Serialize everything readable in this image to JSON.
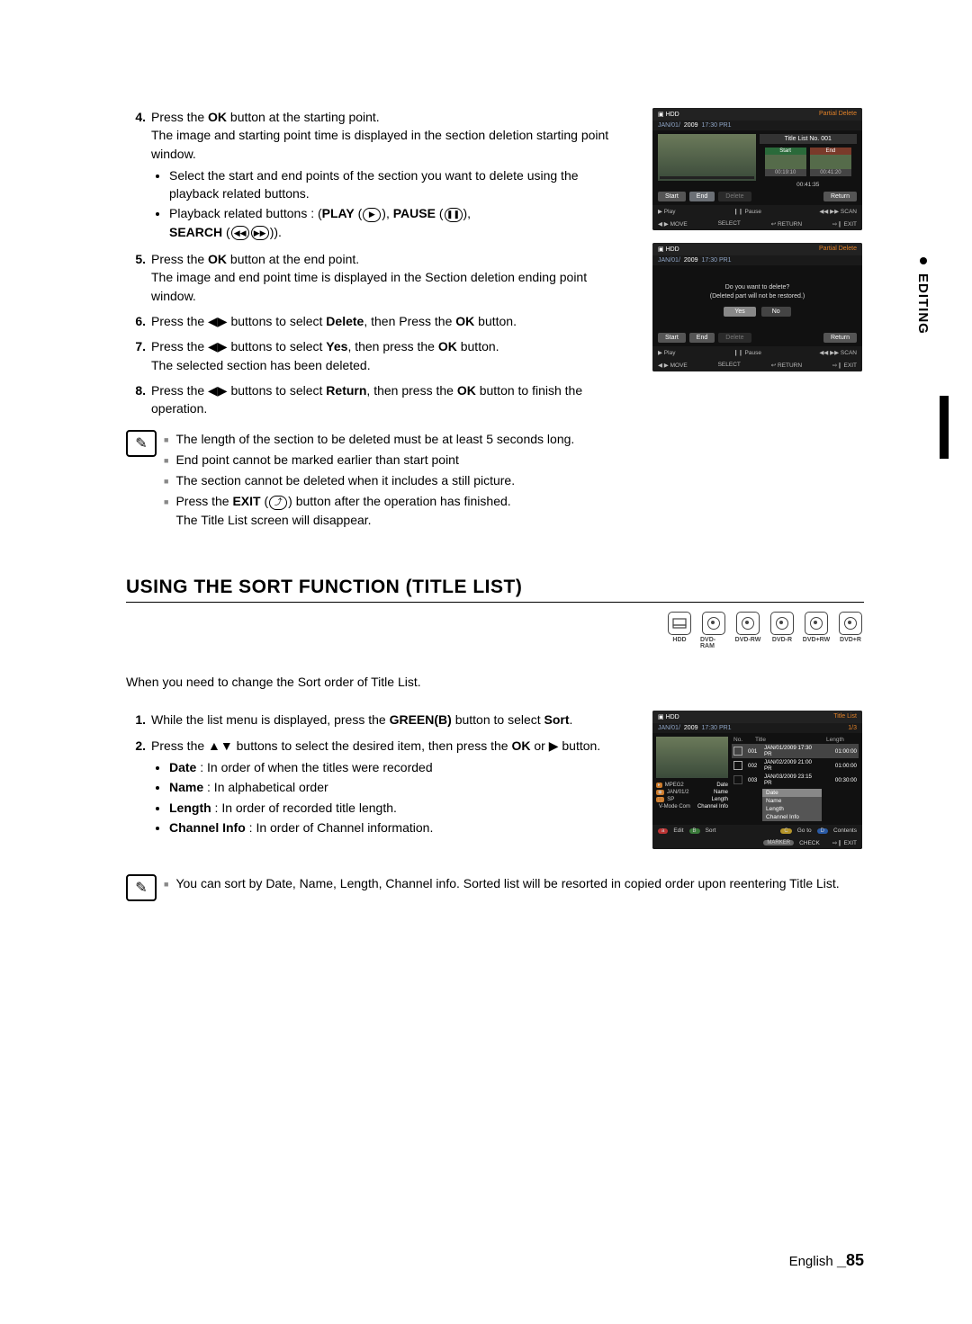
{
  "side_tab": "EDITING",
  "step4": {
    "num": "4.",
    "line1_a": "Press the ",
    "line1_b": "OK",
    "line1_c": " button at the starting point.",
    "line2": "The image and starting point time is displayed in the section deletion starting point window.",
    "b1": "Select the start and end points of the section you want to delete using the playback related buttons.",
    "b2_a": "Playback related buttons : (",
    "b2_play": "PLAY",
    "b2_pause": "PAUSE",
    "b2_search": "SEARCH",
    "b2_end": ")."
  },
  "step5": {
    "num": "5.",
    "l1a": "Press the ",
    "l1b": "OK",
    "l1c": " button at the end point.",
    "l2": "The image and end point time is displayed in the Section deletion ending point window."
  },
  "step6": {
    "num": "6.",
    "a": "Press the ◀▶ buttons to select ",
    "b": "Delete",
    "c": ", then Press the ",
    "d": "OK",
    "e": " button."
  },
  "step7": {
    "num": "7.",
    "a": "Press the ◀▶ buttons to select ",
    "b": "Yes",
    "c": ", then press the ",
    "d": "OK",
    "e": " button.",
    "f": "The selected section has been deleted."
  },
  "step8": {
    "num": "8.",
    "a": "Press the ◀▶ buttons to select ",
    "b": "Return",
    "c": ", then press the ",
    "d": "OK",
    "e": " button to finish the operation."
  },
  "notesA": {
    "n1": "The length of the section to be deleted must be at least 5 seconds long.",
    "n2": "End point cannot be marked earlier than start point",
    "n3": "The section cannot be deleted when it includes a still picture.",
    "n4a": "Press the ",
    "n4b": "EXIT",
    "n4c": " button after the operation has finished.",
    "n4d": "The Title List screen will disappear."
  },
  "heading2": "USING THE SORT FUNCTION (TITLE LIST)",
  "discs": [
    "HDD",
    "DVD-RAM",
    "DVD-RW",
    "DVD-R",
    "DVD+RW",
    "DVD+R"
  ],
  "intro2": "When you need to change the Sort order of Title List.",
  "s1": {
    "num": "1.",
    "a": "While the list menu is displayed, press the ",
    "b": "GREEN(B)",
    "c": " button to select ",
    "d": "Sort",
    "e": "."
  },
  "s2": {
    "num": "2.",
    "a": "Press the ▲▼ buttons to select the desired item, then press the ",
    "b": "OK",
    "c": " or ▶ button.",
    "d_date_b": "Date",
    "d_date": " : In order of when the titles were recorded",
    "d_name_b": "Name",
    "d_name": " : In alphabetical order",
    "d_len_b": "Length",
    "d_len": " : In order of recorded title length.",
    "d_ch_b": "Channel Info",
    "d_ch": " : In order of Channel information."
  },
  "notesB": {
    "n1": "You can sort by Date, Name, Length, Channel info. Sorted list will be resorted in copied order upon reentering Title List."
  },
  "footer": {
    "lang": "English ",
    "page": "_85"
  },
  "shot1": {
    "hdd": "HDD",
    "mode": "Partial Delete",
    "date1": "JAN/01/",
    "date2": "2009",
    "date3": " 17:30 PR1",
    "title": "Title List No. 001",
    "start": "Start",
    "end": "End",
    "t1": "00:19:10",
    "t2": "00:41:20",
    "t3": "00:41:35",
    "btns": [
      "Start",
      "End",
      "Delete",
      "Return"
    ],
    "f_play": "▶ Play",
    "f_pause": "❙❙ Pause",
    "f_scan": "◀◀ ▶▶  SCAN",
    "f_move": "◀ ▶ MOVE",
    "f_sel": "SELECT",
    "f_ret": "↩ RETURN",
    "f_exit": "⇨❙ EXIT"
  },
  "shot2": {
    "hdd": "HDD",
    "mode": "Partial Delete",
    "date1": "JAN/01/",
    "date2": "2009",
    "date3": " 17:30 PR1",
    "msg1": "Do you want to delete?",
    "msg2": "(Deleted part will not be restored.)",
    "yes": "Yes",
    "no": "No",
    "btns": [
      "Start",
      "End",
      "Delete",
      "Return"
    ],
    "f_play": "▶ Play",
    "f_pause": "❙❙ Pause",
    "f_scan": "◀◀ ▶▶  SCAN",
    "f_move": "◀ ▶ MOVE",
    "f_sel": "SELECT",
    "f_ret": "↩ RETURN",
    "f_exit": "⇨❙ EXIT"
  },
  "shot3": {
    "hdd": "HDD",
    "mode": "Title List",
    "date1": "JAN/01/",
    "date2": "2009",
    "date3": " 17:30 PR1",
    "page": "1/3",
    "cols": [
      "No.",
      "Title",
      "Length"
    ],
    "rows": [
      {
        "n": "001",
        "t": "JAN/01/2009 17:30 PR",
        "len": "01:00:00"
      },
      {
        "n": "002",
        "t": "JAN/02/2009 21:00 PR",
        "len": "01:00:00"
      },
      {
        "n": "003",
        "t": "JAN/03/2009 23:15 PR",
        "len": "00:30:00"
      }
    ],
    "stats": [
      [
        "MPEG2",
        "Date"
      ],
      [
        "JAN/01/2",
        "Name"
      ],
      [
        "SP",
        "Length"
      ],
      [
        "V-Mode Com",
        "Channel Info"
      ]
    ],
    "dd": [
      "Date",
      "Name",
      "Length",
      "Channel Info"
    ],
    "f": [
      [
        "red",
        "a",
        "Edit"
      ],
      [
        "green",
        "B",
        "Sort"
      ],
      [
        "yellow",
        "C",
        "Go to"
      ],
      [
        "blue",
        "D",
        "Contents"
      ]
    ],
    "f2_check": "CHECK",
    "f2_marker": "MARKER",
    "f2_exit": "⇨❙ EXIT"
  }
}
